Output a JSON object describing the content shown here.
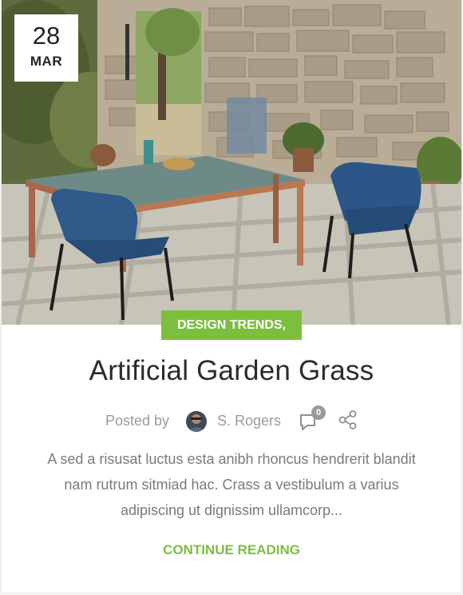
{
  "post": {
    "date": {
      "day": "28",
      "month": "MAR"
    },
    "category": "DESIGN TRENDS,",
    "title": "Artificial Garden Grass",
    "meta": {
      "posted_by_label": "Posted by",
      "author": "S. Rogers",
      "comment_count": "0"
    },
    "excerpt": "A sed a risusat luctus esta anibh rhoncus hendrerit blandit nam rutrum sitmiad hac. Crass a vestibulum a varius adipiscing ut dignissim ullamcorp...",
    "read_more": "CONTINUE READING"
  },
  "colors": {
    "accent": "#7cbf3f",
    "title": "#2b2b2b",
    "meta": "#9a9a9a",
    "body": "#7a7a7a"
  },
  "icons": [
    "avatar",
    "comment-icon",
    "share-icon"
  ]
}
